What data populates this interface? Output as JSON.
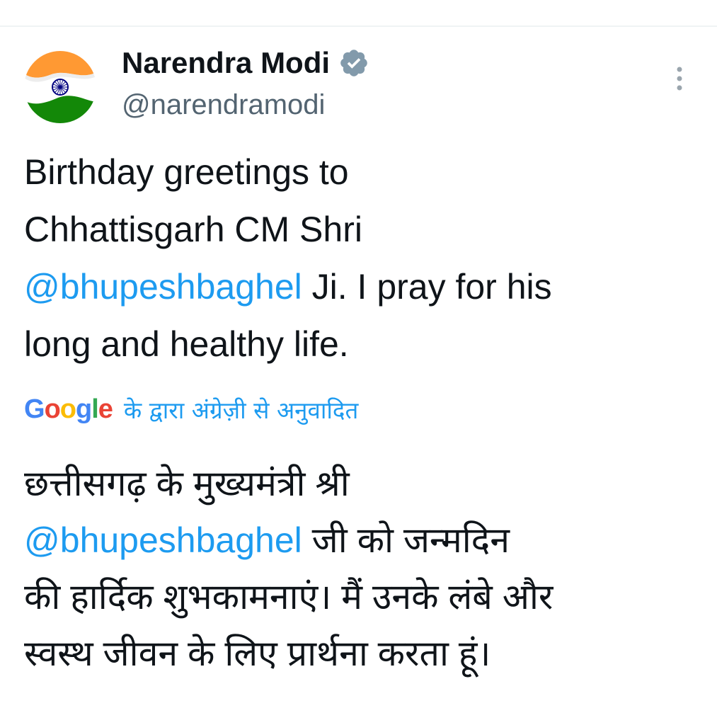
{
  "tweet": {
    "author_name": "Narendra Modi",
    "handle": "@narendramodi",
    "verified_icon": "verified-badge-icon",
    "more_icon": "more-vertical-icon",
    "text_lines": [
      {
        "plain": "Birthday greetings to"
      },
      {
        "plain": "Chhattisgarh CM Shri"
      },
      {
        "mention": "@bhupeshbaghel",
        "plain": " Ji. I pray for his"
      },
      {
        "plain": "long and healthy life."
      }
    ]
  },
  "translation": {
    "provider": {
      "letters": [
        "G",
        "o",
        "o",
        "g",
        "l",
        "e"
      ],
      "colors": [
        "#4285F4",
        "#EA4335",
        "#FBBC05",
        "#4285F4",
        "#34A853",
        "#EA4335"
      ]
    },
    "label": "के द्वारा अंग्रेज़ी से अनुवादित",
    "text_lines": [
      {
        "plain": "छत्तीसगढ़ के मुख्यमंत्री श्री"
      },
      {
        "mention": "@bhupeshbaghel",
        "plain": " जी को जन्मदिन"
      },
      {
        "plain": "की हार्दिक शुभकामनाएं। मैं उनके लंबे और"
      },
      {
        "plain": "स्वस्थ जीवन के लिए प्रार्थना करता हूं।"
      }
    ]
  },
  "colors": {
    "accent": "#1d9bf0",
    "text": "#0f1419",
    "secondary": "#536471",
    "verified_badge": "#829aab",
    "flag_saffron": "#ff9933",
    "flag_green": "#138808",
    "chakra_blue": "#000080"
  }
}
